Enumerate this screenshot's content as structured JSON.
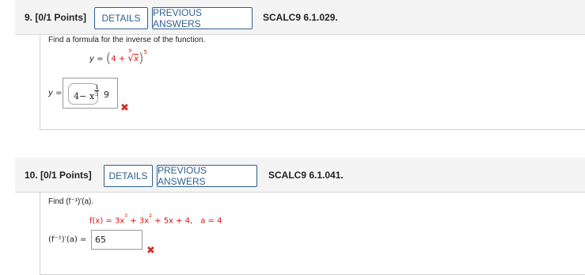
{
  "q9": {
    "number": "9. [0/1 Points]",
    "details_label": "DETAILS",
    "prev_label": "PREVIOUS ANSWERS",
    "ref": "SCALC9 6.1.029.",
    "prompt": "Find a formula for the inverse of the function.",
    "function": {
      "lhs": "y = ",
      "paren_open": "(",
      "const": "4",
      "plus": " + ",
      "root_index": "9",
      "radicand": "x",
      "paren_close": ")",
      "exponent": "5"
    },
    "answer_label": "y =",
    "answer": {
      "const": "4",
      "minus": " − ",
      "var": "x",
      "exp_num": "1",
      "exp_den": "5",
      "trailing": "9"
    },
    "result_icon": "x-mark-icon"
  },
  "q10": {
    "number": "10. [0/1 Points]",
    "details_label": "DETAILS",
    "prev_label": "PREVIOUS ANSWERS",
    "ref": "SCALC9 6.1.041.",
    "prompt": "Find (f⁻¹)′(a).",
    "function": {
      "lhs": "f(x) = 3x",
      "e1": "3",
      "mid1": " + 3x",
      "e2": "2",
      "rest": " + 5x + 4,",
      "a_text": "a = 4"
    },
    "answer_label": "(f⁻¹)′(a) =",
    "answer_value": "65",
    "result_icon": "x-mark-icon"
  },
  "colors": {
    "accent": "#2f5f8f",
    "error": "#d03030",
    "highlight": "#dd1111"
  }
}
